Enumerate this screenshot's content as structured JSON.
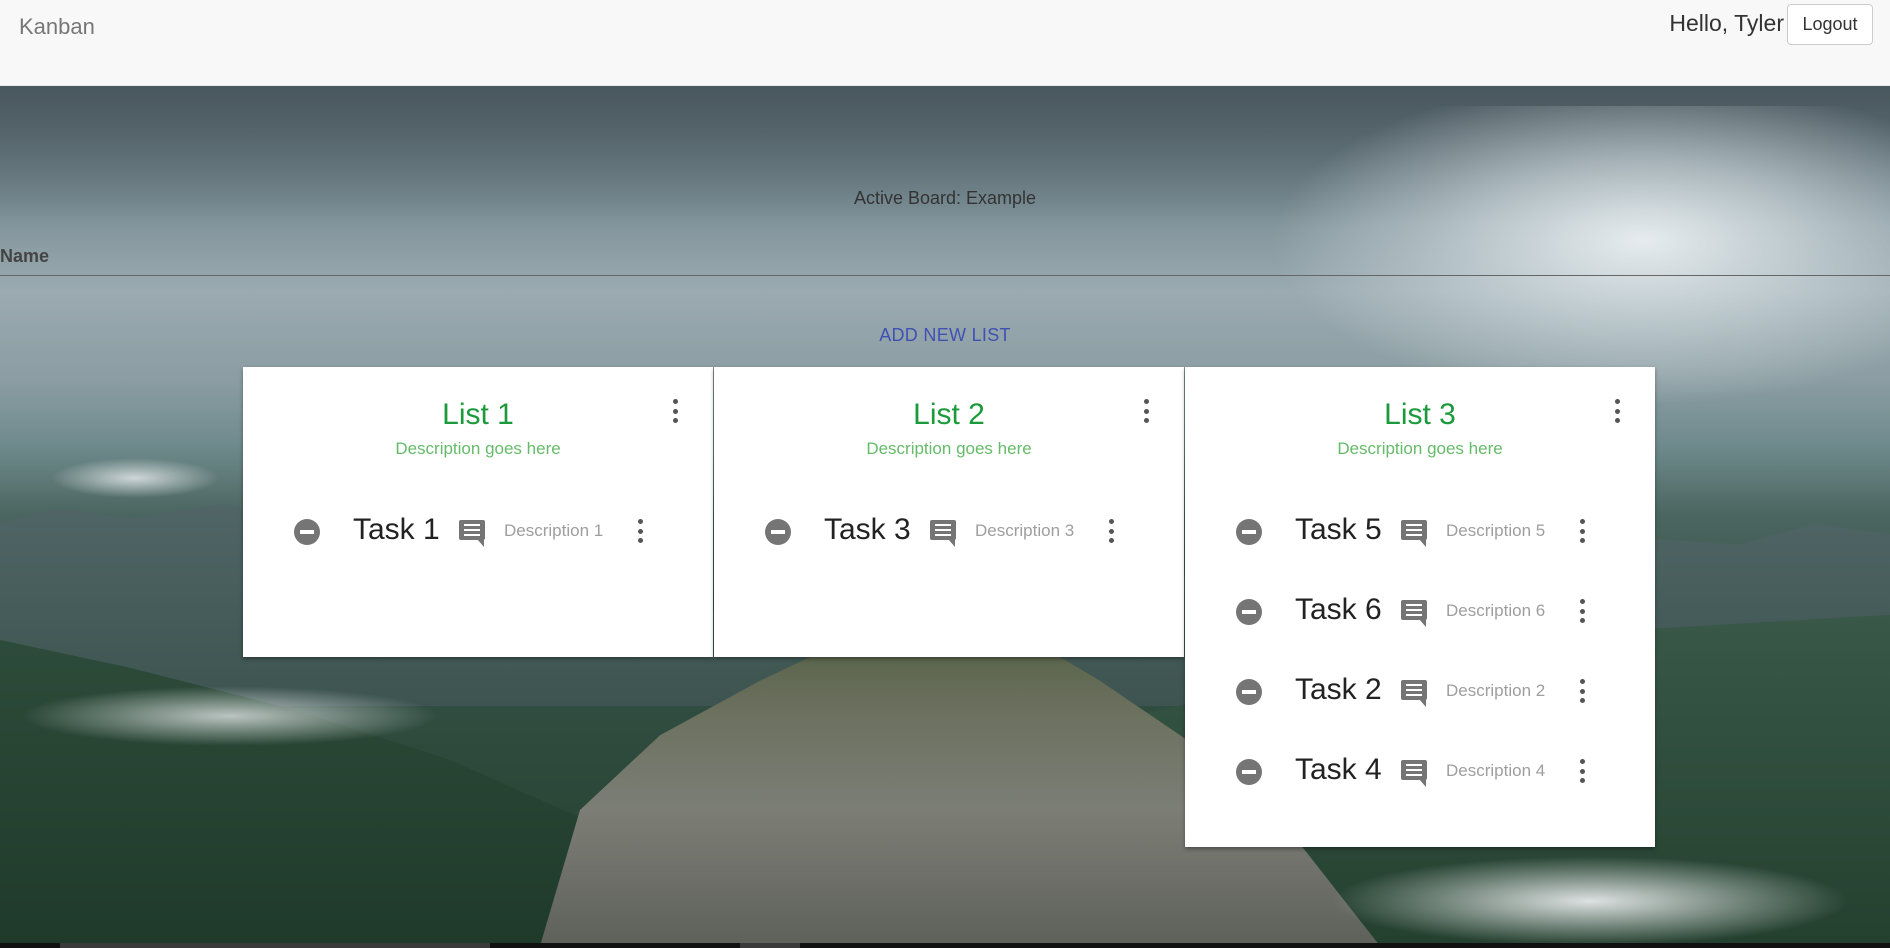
{
  "navbar": {
    "brand": "Kanban",
    "greeting": "Hello, Tyler",
    "logout_label": "Logout"
  },
  "board": {
    "active_label": "Active Board: Example",
    "name_label": "Name",
    "name_value": "",
    "add_list_label": "ADD NEW LIST"
  },
  "lists": [
    {
      "title": "List 1",
      "description": "Description goes here",
      "tasks": [
        {
          "name": "Task 1",
          "description": "Description 1"
        }
      ]
    },
    {
      "title": "List 2",
      "description": "Description goes here",
      "tasks": [
        {
          "name": "Task 3",
          "description": "Description 3"
        }
      ]
    },
    {
      "title": "List 3",
      "description": "Description goes here",
      "tasks": [
        {
          "name": "Task 5",
          "description": "Description 5"
        },
        {
          "name": "Task 6",
          "description": "Description 6"
        },
        {
          "name": "Task 2",
          "description": "Description 2"
        },
        {
          "name": "Task 4",
          "description": "Description 4"
        }
      ]
    }
  ],
  "icons": {
    "remove": "remove-circle-icon",
    "comment": "comment-icon",
    "menu": "more-vert-icon"
  },
  "colors": {
    "list_title": "#1a9a3a",
    "list_description": "#66bb6a",
    "add_list": "#3f51b5",
    "icon_gray": "#757575"
  }
}
